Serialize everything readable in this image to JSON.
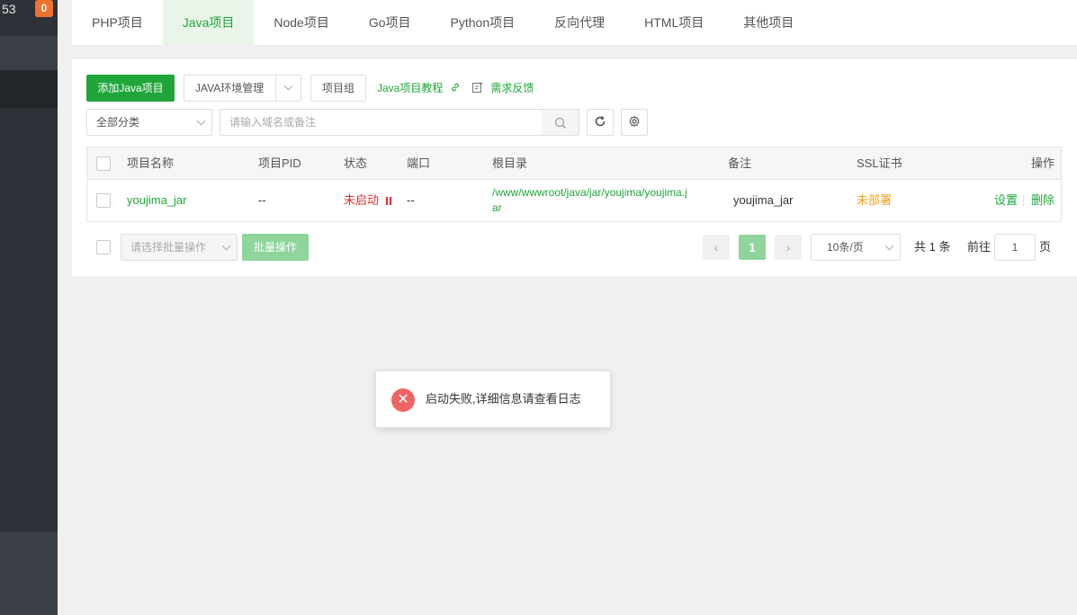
{
  "sidebar": {
    "number": "53",
    "badge": "0"
  },
  "tabs": [
    {
      "label": "PHP项目"
    },
    {
      "label": "Java项目"
    },
    {
      "label": "Node项目"
    },
    {
      "label": "Go项目"
    },
    {
      "label": "Python项目"
    },
    {
      "label": "反向代理"
    },
    {
      "label": "HTML项目"
    },
    {
      "label": "其他项目"
    }
  ],
  "toolbar": {
    "add_label": "添加Java项目",
    "env_label": "JAVA环境管理",
    "group_label": "项目组",
    "tutorial_label": "Java项目教程",
    "feedback_label": "需求反馈",
    "category_value": "全部分类",
    "search_placeholder": "请输入域名或备注"
  },
  "table": {
    "headers": {
      "name": "项目名称",
      "pid": "项目PID",
      "status": "状态",
      "port": "端口",
      "root": "根目录",
      "remark": "备注",
      "ssl": "SSL证书",
      "action": "操作"
    },
    "rows": [
      {
        "name": "youjima_jar",
        "pid": "--",
        "status": "未启动",
        "port": "--",
        "root_line1": "/www/wwwroot/java/jar/youjima/youjima.j",
        "root_line2": "ar",
        "remark": "youjima_jar",
        "ssl": "未部署",
        "action_settings": "设置",
        "action_delete": "删除"
      }
    ]
  },
  "footer": {
    "batch_placeholder": "请选择批量操作",
    "batch_button": "批量操作",
    "current_page": "1",
    "page_size": "10条/页",
    "total": "共 1 条",
    "goto_prefix": "前往",
    "goto_value": "1",
    "goto_suffix": "页"
  },
  "toast": {
    "message": "启动失败,详细信息请查看日志"
  },
  "colors": {
    "accent": "#20a53a",
    "error": "#e12c2c",
    "warning": "#f0a020",
    "sidebar": "#2e3138"
  }
}
